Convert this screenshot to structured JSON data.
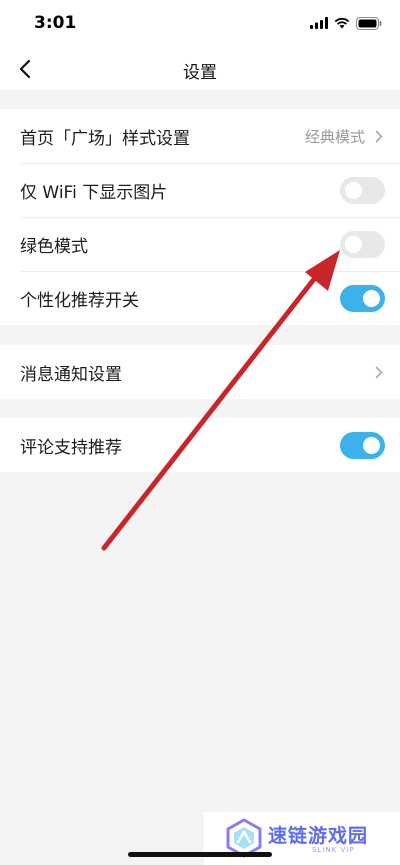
{
  "status_bar": {
    "time": "3:01"
  },
  "nav": {
    "title": "设置",
    "back_icon": "chevron-left-icon"
  },
  "groups": [
    {
      "rows": [
        {
          "label": "首页「广场」样式设置",
          "value": "经典模式",
          "control": "chevron"
        },
        {
          "label": "仅 WiFi 下显示图片",
          "control": "toggle",
          "checked": false
        },
        {
          "label": "绿色模式",
          "control": "toggle",
          "checked": false
        },
        {
          "label": "个性化推荐开关",
          "control": "toggle",
          "checked": true
        }
      ]
    },
    {
      "rows": [
        {
          "label": "消息通知设置",
          "control": "chevron"
        }
      ]
    },
    {
      "rows": [
        {
          "label": "评论支持推荐",
          "control": "toggle",
          "checked": true
        }
      ]
    }
  ],
  "watermark": {
    "title": "速链游戏园",
    "subtitle": "SLINK VIP"
  },
  "colors": {
    "toggle_on": "#3bb2ea",
    "toggle_off": "#e8e8e8",
    "annotation_arrow": "#c8262a",
    "watermark_accent": "#5e6cf0"
  }
}
